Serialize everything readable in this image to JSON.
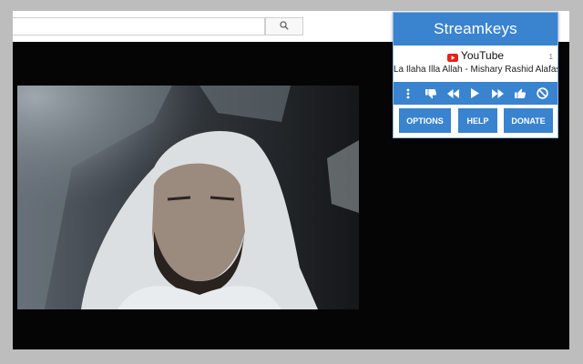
{
  "search": {
    "placeholder": "",
    "button_icon": "search-icon"
  },
  "popup": {
    "title": "Streamkeys",
    "site": {
      "icon": "youtube-icon",
      "name": "YouTube",
      "tab_count": "1"
    },
    "track": "La Ilaha Illa Allah - Mishary Rashid Alafasy",
    "controls": [
      "more-vert-icon",
      "thumbs-down-icon",
      "rewind-icon",
      "play-icon",
      "fast-forward-icon",
      "thumbs-up-icon",
      "disable-icon"
    ],
    "buttons": {
      "options": "OPTIONS",
      "help": "HELP",
      "donate": "DONATE"
    },
    "accent_color": "#3a83cf"
  }
}
